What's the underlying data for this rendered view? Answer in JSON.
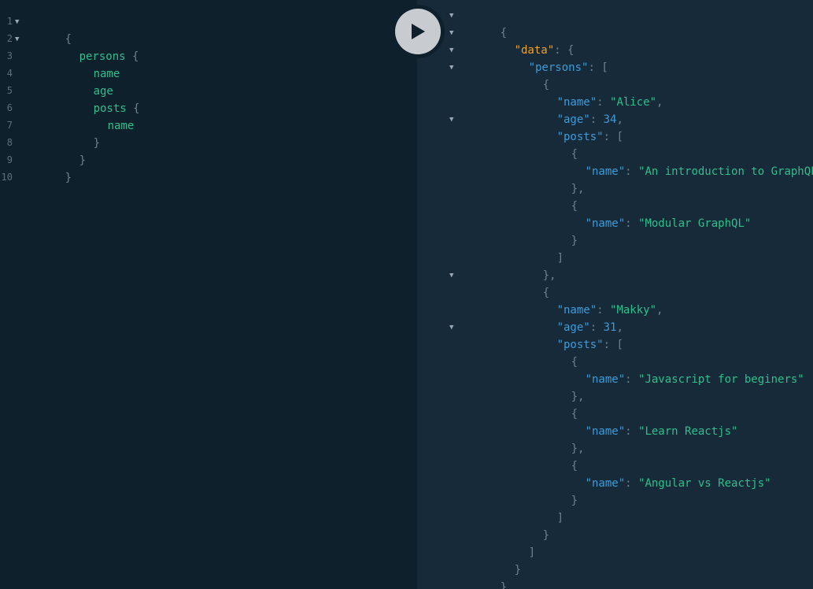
{
  "query_editor": {
    "line_numbers": [
      "1",
      "2",
      "3",
      "4",
      "5",
      "6",
      "7",
      "8",
      "9",
      "10"
    ],
    "lines": [
      {
        "text": "{",
        "kind": "punct"
      },
      {
        "text": "persons",
        "suffix": " {",
        "kind": "field"
      },
      {
        "text": "name",
        "kind": "field"
      },
      {
        "text": "age",
        "kind": "field"
      },
      {
        "text": "posts",
        "suffix": " {",
        "kind": "field"
      },
      {
        "text": "name",
        "kind": "field"
      },
      {
        "text": "}",
        "kind": "punct"
      },
      {
        "text": "}",
        "kind": "punct"
      },
      {
        "text": "}",
        "kind": "punct"
      }
    ]
  },
  "result_viewer": {
    "tokens": {
      "open_brace": "{",
      "close_brace": "}",
      "close_brace_comma": "},",
      "open_bracket": "[",
      "close_bracket": "]",
      "colon": ": ",
      "comma": ","
    },
    "keys": {
      "data": "\"data\"",
      "persons": "\"persons\"",
      "name": "\"name\"",
      "age": "\"age\"",
      "posts": "\"posts\""
    },
    "persons": [
      {
        "name": "\"Alice\"",
        "age": "34",
        "posts": [
          "\"An introduction to GraphQL\"",
          "\"Modular GraphQL\""
        ]
      },
      {
        "name": "\"Makky\"",
        "age": "31",
        "posts": [
          "\"Javascript for beginers\"",
          "\"Learn Reactjs\"",
          "\"Angular vs Reactjs\""
        ]
      }
    ]
  },
  "toolbar": {
    "execute_icon": "play-icon"
  },
  "colors": {
    "editor_bg": "#0f202d",
    "result_bg": "#172a3a",
    "field": "#2fbf8a",
    "key": "#3f9bd6",
    "data_key": "#f0a129",
    "punctuation": "#6f818e"
  }
}
